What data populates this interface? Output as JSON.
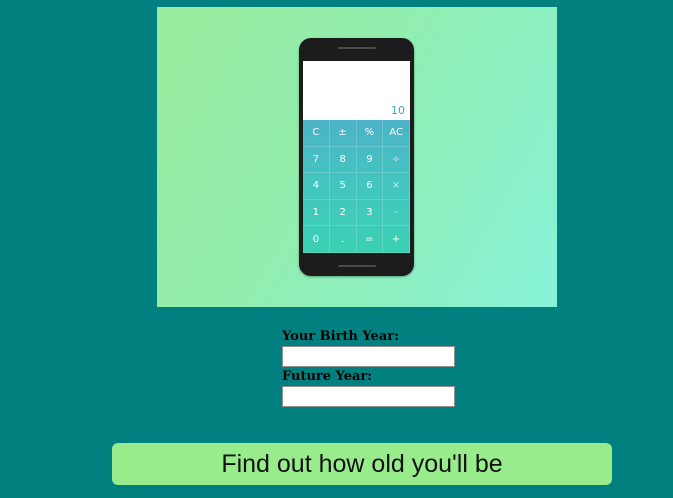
{
  "hero": {
    "calculator": {
      "display_value": "10",
      "keys": [
        "C",
        "±",
        "%",
        "AC",
        "7",
        "8",
        "9",
        "÷",
        "4",
        "5",
        "6",
        "×",
        "1",
        "2",
        "3",
        "-",
        "0",
        ".",
        "=",
        "+"
      ]
    }
  },
  "form": {
    "birth_year_label": "Your Birth Year:",
    "birth_year_value": "",
    "future_year_label": "Future Year:",
    "future_year_value": ""
  },
  "submit_label": "Find out how old you'll be",
  "colors": {
    "background": "#028080",
    "button": "#98ec8c",
    "hero_gradient_start": "#98ec9c",
    "hero_gradient_end": "#86f2d8"
  }
}
